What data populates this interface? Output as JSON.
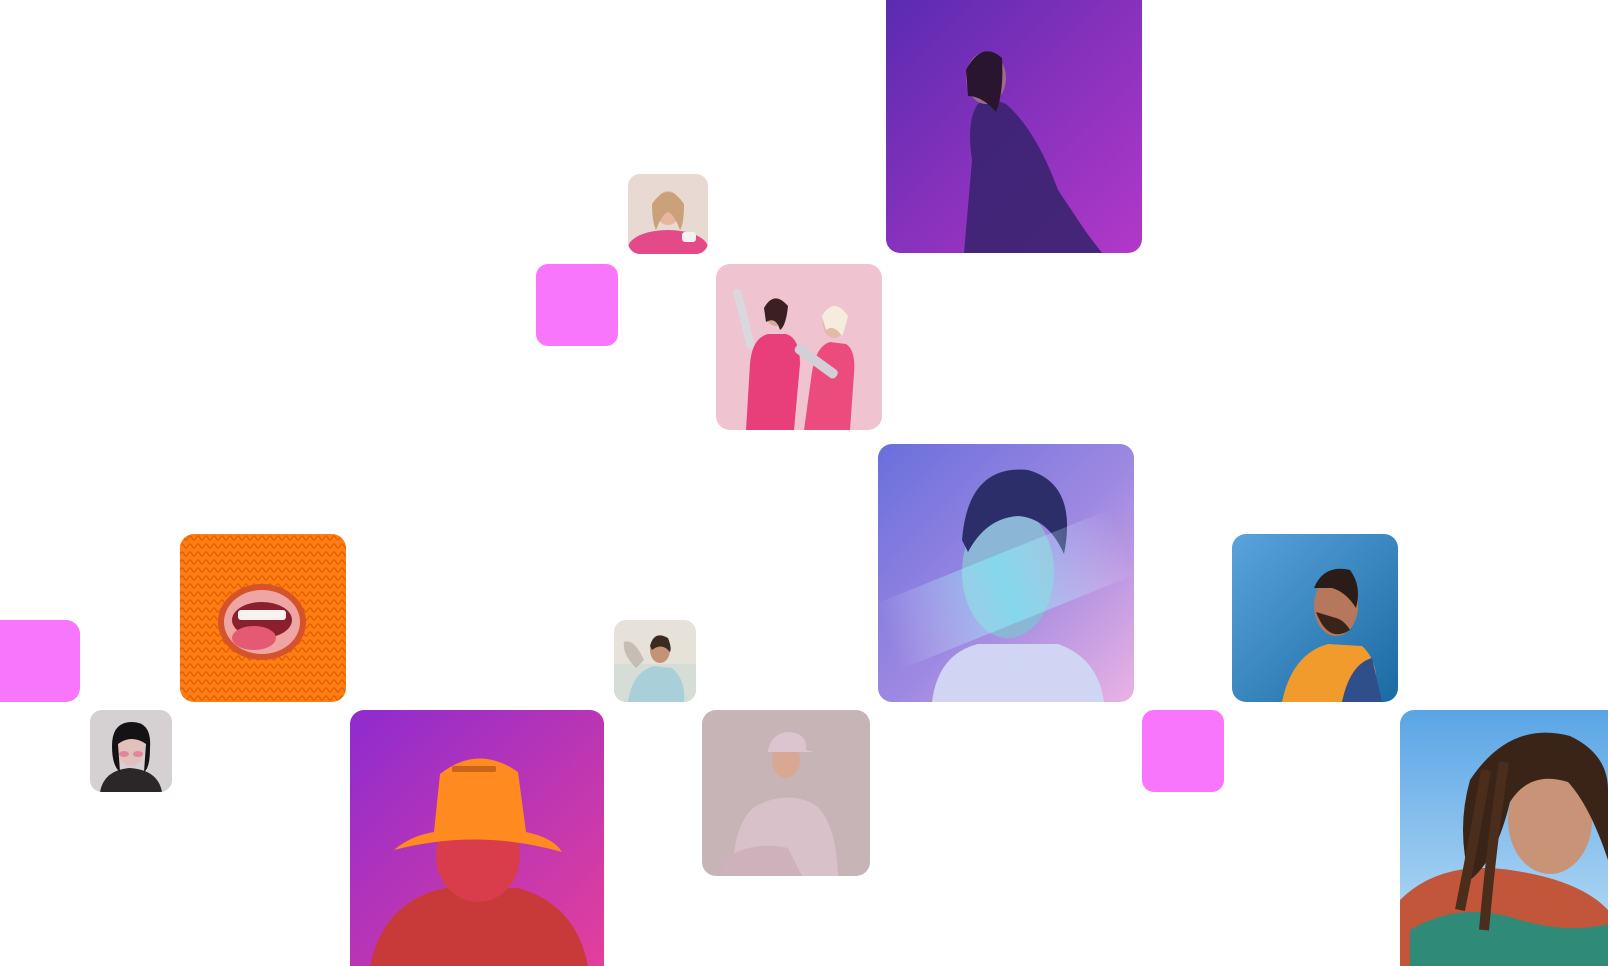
{
  "tiles": [
    {
      "id": "t1",
      "kind": "photo",
      "subject": "woman-in-lace-dress-purple-backdrop",
      "bg_from": "#5a2bb0",
      "bg_to": "#b338c9"
    },
    {
      "id": "t2",
      "kind": "photo",
      "subject": "blonde-woman-pink-fur",
      "bg_from": "#e9d9d3",
      "bg_to": "#b6687a"
    },
    {
      "id": "t3",
      "kind": "accent",
      "color": "#f776fb"
    },
    {
      "id": "t4",
      "kind": "photo",
      "subject": "duo-pink-jackets-with-props",
      "bg_from": "#f0c7d2",
      "bg_to": "#e8a9bb"
    },
    {
      "id": "t5",
      "kind": "photo",
      "subject": "man-portrait-light-streak",
      "bg_from": "#7a7fe0",
      "bg_to": "#e8a6e6"
    },
    {
      "id": "t6",
      "kind": "photo",
      "subject": "mouth-through-orange-knit",
      "bg_from": "#ff8a1e",
      "bg_to": "#ff6a00"
    },
    {
      "id": "t7",
      "kind": "photo",
      "subject": "bearded-man-profile-blue",
      "bg_from": "#4f9bd8",
      "bg_to": "#1f6fa8"
    },
    {
      "id": "t8",
      "kind": "accent",
      "color": "#f776fb"
    },
    {
      "id": "t9",
      "kind": "photo",
      "subject": "man-leaning-on-wall",
      "bg_from": "#e7e3dc",
      "bg_to": "#b7c9cf"
    },
    {
      "id": "t10",
      "kind": "photo",
      "subject": "woman-dark-bangs-grey",
      "bg_from": "#d7d3d4",
      "bg_to": "#9e9a9b"
    },
    {
      "id": "t11",
      "kind": "photo",
      "subject": "man-orange-bucket-hat-magenta",
      "bg_from": "#9a2bd0",
      "bg_to": "#e13f9f"
    },
    {
      "id": "t12",
      "kind": "photo",
      "subject": "man-lilac-hoodie-seated",
      "bg_from": "#c6b3b5",
      "bg_to": "#b79fa5"
    },
    {
      "id": "t13",
      "kind": "accent",
      "color": "#f776fb"
    },
    {
      "id": "t14",
      "kind": "photo",
      "subject": "woman-braids-sky-blue",
      "bg_from": "#5ea7e6",
      "bg_to": "#b6d9f4"
    }
  ]
}
